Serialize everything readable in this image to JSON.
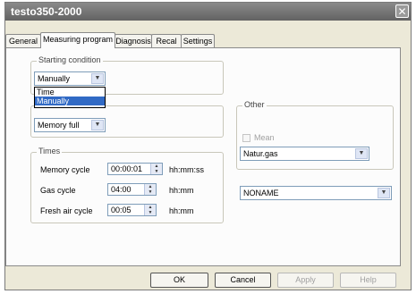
{
  "window": {
    "title": "testo350-2000",
    "close_label": "✕"
  },
  "tabs": [
    "General",
    "Measuring program",
    "Diagnosis",
    "Recal",
    "Settings"
  ],
  "starting_condition": {
    "label": "Starting condition",
    "value": "Manually",
    "options": [
      "Time",
      "Manually"
    ],
    "selected_index": 1
  },
  "stop_condition": {
    "value": "Memory full"
  },
  "times": {
    "label": "Times",
    "rows": [
      {
        "label": "Memory cycle",
        "value": "00:00:01",
        "unit": "hh:mm:ss"
      },
      {
        "label": "Gas cycle",
        "value": "04:00",
        "unit": "hh:mm"
      },
      {
        "label": "Fresh air cycle",
        "value": "00:05",
        "unit": "hh:mm"
      }
    ]
  },
  "other": {
    "label": "Other",
    "mean_label": "Mean",
    "mean_checked": false,
    "fuel": "Natur.gas"
  },
  "name_combo": {
    "value": "NONAME"
  },
  "buttons": {
    "ok": "OK",
    "cancel": "Cancel",
    "apply": "Apply",
    "help": "Help"
  },
  "icons": {
    "dropdown": "chevron-down-icon",
    "spin": "spin-updown-icon",
    "close": "close-icon"
  }
}
